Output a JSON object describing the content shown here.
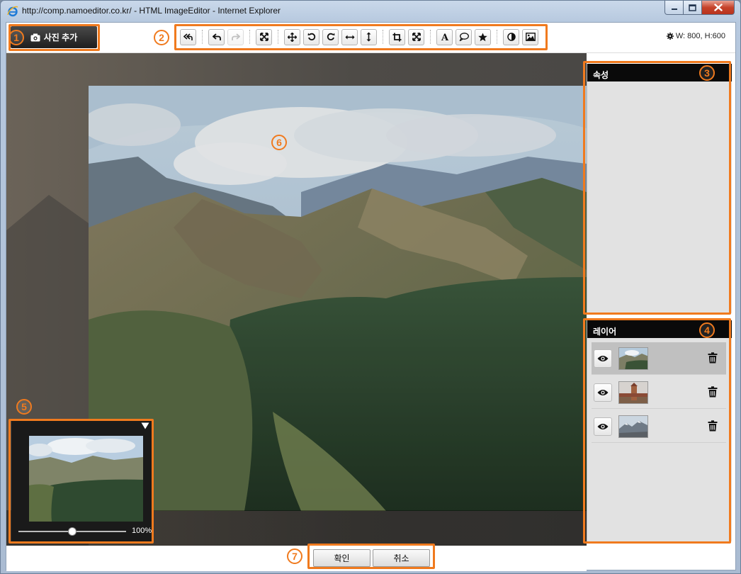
{
  "window": {
    "title": "http://comp.namoeditor.co.kr/ - HTML ImageEditor - Internet Explorer"
  },
  "toolbar": {
    "add_photo_label": "사진 추가",
    "size_info": "W: 800, H:600",
    "buttons": [
      "undo-all",
      "undo",
      "redo",
      "fit",
      "move",
      "rotate-left",
      "rotate-right",
      "flip-horizontal",
      "flip-vertical",
      "crop",
      "resize",
      "text",
      "speech-bubble",
      "star",
      "contrast",
      "image"
    ]
  },
  "panels": {
    "properties_title": "속성",
    "layers_title": "레이어",
    "layers": [
      {
        "thumb": "mountain-landscape",
        "selected": true
      },
      {
        "thumb": "tower-bridge",
        "selected": false
      },
      {
        "thumb": "snowy-mountains",
        "selected": false
      }
    ]
  },
  "navigator": {
    "zoom_label": "100%",
    "zoom_fraction": 0.5
  },
  "buttons": {
    "ok": "확인",
    "cancel": "취소"
  },
  "annotations": [
    "1",
    "2",
    "3",
    "4",
    "5",
    "6",
    "7"
  ],
  "colors": {
    "accent": "#f07a1e",
    "panel_header": "#0a0a0a",
    "panel_bg": "#e2e2e2"
  }
}
